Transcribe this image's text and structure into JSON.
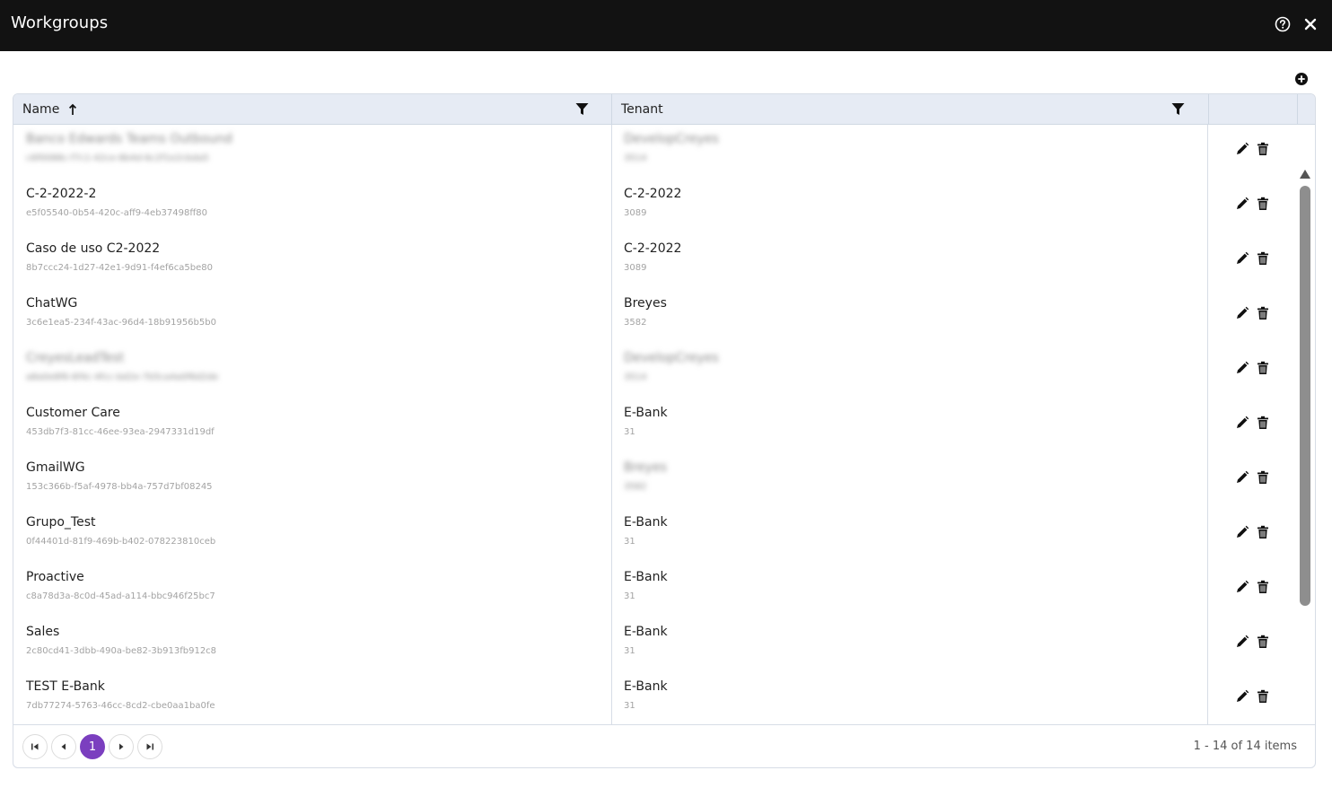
{
  "window": {
    "title": "Workgroups"
  },
  "grid": {
    "columns": {
      "name": "Name",
      "tenant": "Tenant"
    },
    "sort": {
      "column": "Name",
      "direction": "ascending"
    },
    "rows": [
      {
        "name": "Banco Edwards Teams Outbound",
        "id": "c6f0088c-f7c1-42ce-8b4d-6c2f1e2cbda5",
        "tenant": "DevelopCreyes",
        "tenant_id": "3514",
        "redacted": true
      },
      {
        "name": "C-2-2022-2",
        "id": "e5f05540-0b54-420c-aff9-4eb37498ff80",
        "tenant": "C-2-2022",
        "tenant_id": "3089",
        "redacted": false
      },
      {
        "name": "Caso de uso C2-2022",
        "id": "8b7ccc24-1d27-42e1-9d91-f4ef6ca5be80",
        "tenant": "C-2-2022",
        "tenant_id": "3089",
        "redacted": false
      },
      {
        "name": "ChatWG",
        "id": "3c6e1ea5-234f-43ac-96d4-18b91956b5b0",
        "tenant": "Breyes",
        "tenant_id": "3582",
        "redacted": false
      },
      {
        "name": "CreyesLeadTest",
        "id": "a8a0e8f6-6f4c-4fcc-bd2e-7b5ca4a0f6d2de",
        "tenant": "DevelopCreyes",
        "tenant_id": "3514",
        "redacted": true
      },
      {
        "name": "Customer Care",
        "id": "453db7f3-81cc-46ee-93ea-2947331d19df",
        "tenant": "E-Bank",
        "tenant_id": "31",
        "redacted": false
      },
      {
        "name": "GmailWG",
        "id": "153c366b-f5af-4978-bb4a-757d7bf08245",
        "tenant": "Breyes",
        "tenant_id": "3582",
        "redacted": false,
        "tenant_redacted": true
      },
      {
        "name": "Grupo_Test",
        "id": "0f44401d-81f9-469b-b402-078223810ceb",
        "tenant": "E-Bank",
        "tenant_id": "31",
        "redacted": false
      },
      {
        "name": "Proactive",
        "id": "c8a78d3a-8c0d-45ad-a114-bbc946f25bc7",
        "tenant": "E-Bank",
        "tenant_id": "31",
        "redacted": false
      },
      {
        "name": "Sales",
        "id": "2c80cd41-3dbb-490a-be82-3b913fb912c8",
        "tenant": "E-Bank",
        "tenant_id": "31",
        "redacted": false
      },
      {
        "name": "TEST E-Bank",
        "id": "7db77274-5763-46cc-8cd2-cbe0aa1ba0fe",
        "tenant": "E-Bank",
        "tenant_id": "31",
        "redacted": false
      }
    ]
  },
  "pager": {
    "current_page": "1",
    "info": "1 - 14 of 14 items"
  },
  "icons": {
    "help": "help-circle-icon",
    "close": "close-icon",
    "add": "add-circle-icon",
    "sort": "arrow-up-icon",
    "filter": "filter-icon",
    "edit": "pencil-icon",
    "delete": "trash-icon",
    "first": "first-page-icon",
    "prev": "previous-page-icon",
    "next": "next-page-icon",
    "last": "last-page-icon"
  },
  "colors": {
    "titlebar": "#121212",
    "header": "#e6ebf4",
    "accent": "#7b3fbf"
  }
}
